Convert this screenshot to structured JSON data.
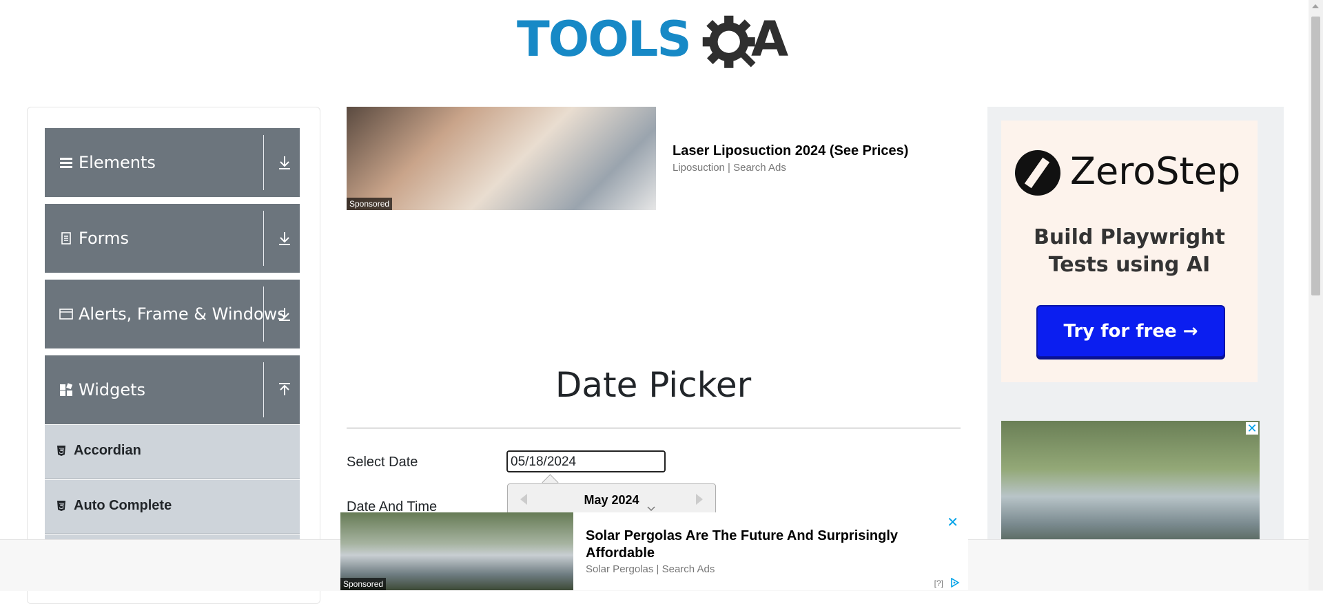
{
  "header": {
    "logo_text": "TOOLS",
    "logo_a": "A"
  },
  "sidebar": {
    "groups": [
      {
        "label": "Elements",
        "icon": "menu-icon",
        "arrow": "download-arrow-icon"
      },
      {
        "label": "Forms",
        "icon": "document-icon",
        "arrow": "download-arrow-icon"
      },
      {
        "label": "Alerts, Frame & Windows",
        "icon": "window-icon",
        "arrow": "download-arrow-icon"
      },
      {
        "label": "Widgets",
        "icon": "widgets-icon",
        "arrow": "upload-arrow-icon"
      }
    ],
    "subitems": [
      {
        "label": "Accordian",
        "icon": "html5-icon"
      },
      {
        "label": "Auto Complete",
        "icon": "html5-icon"
      }
    ]
  },
  "ad_top": {
    "badge": "Sponsored",
    "title": "Laser Liposuction 2024 (See Prices)",
    "subtitle": "Liposuction | Search Ads"
  },
  "ad_right": {
    "brand": "ZeroStep",
    "tagline": "Build Playwright Tests using AI",
    "cta": "Try for free →",
    "close": "✕"
  },
  "main": {
    "title": "Date Picker",
    "select_date_label": "Select Date",
    "select_date_value": "05/18/2024",
    "date_time_label": "Date And Time",
    "calendar_month": "May 2024"
  },
  "ad_bottom": {
    "badge": "Sponsored",
    "title": "Solar Pergolas Are The Future And Surprisingly Affordable",
    "subtitle": "Solar Pergolas | Search Ads",
    "close": "✕",
    "info": "[?]"
  },
  "colors": {
    "brand_blue": "#1789c6",
    "sidebar_group": "#6c757d",
    "sidebar_subitem": "#ced4da",
    "cta_blue": "#0b1ef0",
    "adchoice_blue": "#00a2e8"
  }
}
